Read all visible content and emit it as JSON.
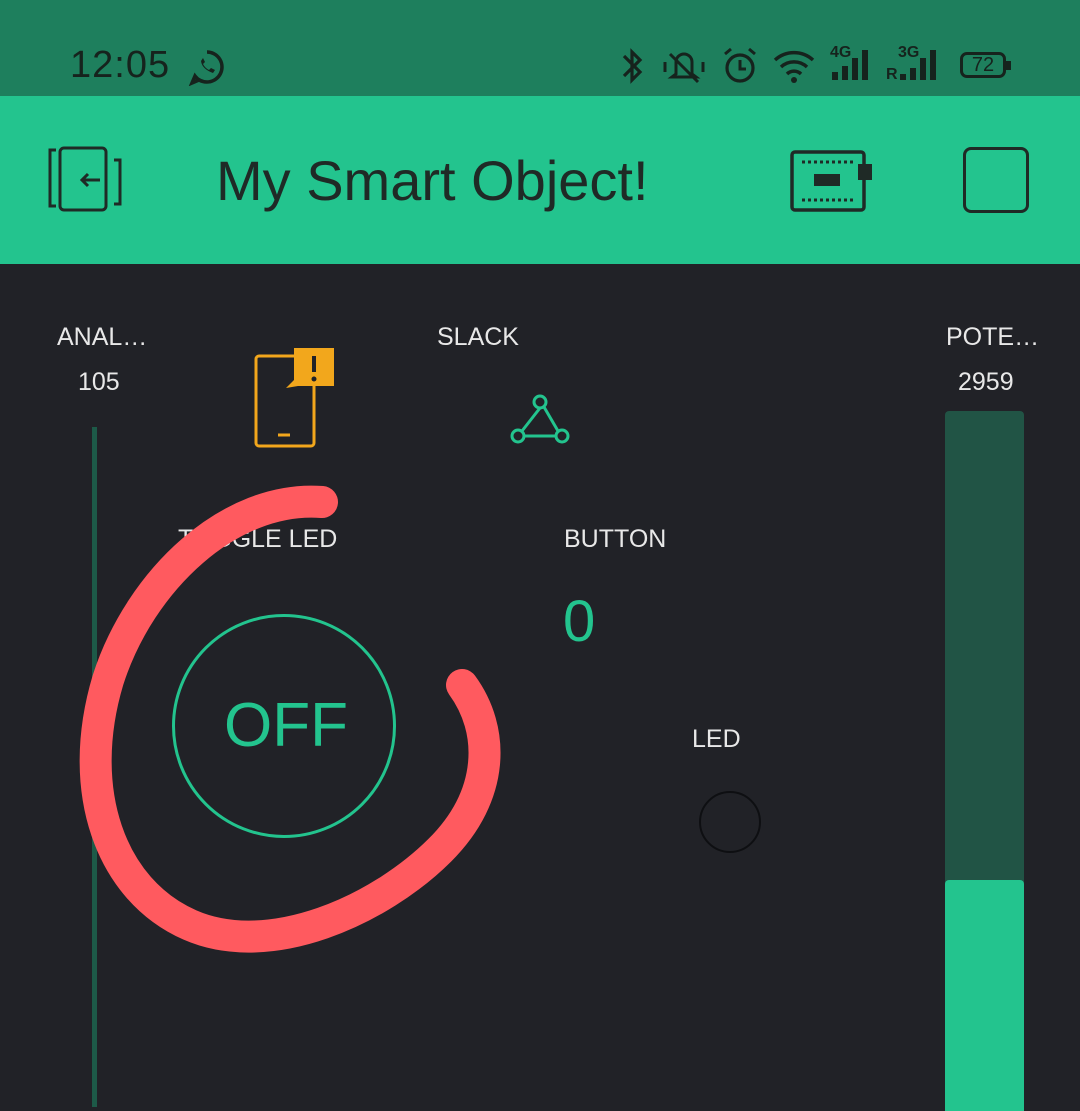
{
  "status_bar": {
    "time": "12:05",
    "icons": [
      "whatsapp-icon",
      "bluetooth-icon",
      "vibrate-mute-icon",
      "alarm-icon",
      "wifi-icon",
      "signal-4g-icon",
      "signal-3g-icon",
      "battery-icon"
    ],
    "network_4g": "4G",
    "network_3g": "3G",
    "roaming": "R",
    "battery": "72"
  },
  "app_bar": {
    "title": "My Smart Object!",
    "icons": [
      "exit-icon",
      "device-board-icon",
      "stop-square-icon"
    ]
  },
  "widgets": {
    "analog": {
      "label": "ANAL…",
      "value": "105"
    },
    "notification": {
      "icon": "phone-notification-icon"
    },
    "slack": {
      "label": "SLACK",
      "icon": "webhook-icon"
    },
    "potentiometer": {
      "label": "POTE…",
      "value": "2959",
      "level": 0.33
    },
    "toggle_led": {
      "label": "TOGGLE LED",
      "state": "OFF"
    },
    "button": {
      "label": "BUTTON",
      "value": "0"
    },
    "led": {
      "label": "LED"
    }
  },
  "colors": {
    "status_bar": "#1e7f5d",
    "app_bar": "#23c48e",
    "background": "#212227",
    "accent": "#23c48e",
    "notification": "#f2a71c",
    "annotation": "#ff5a5f"
  }
}
